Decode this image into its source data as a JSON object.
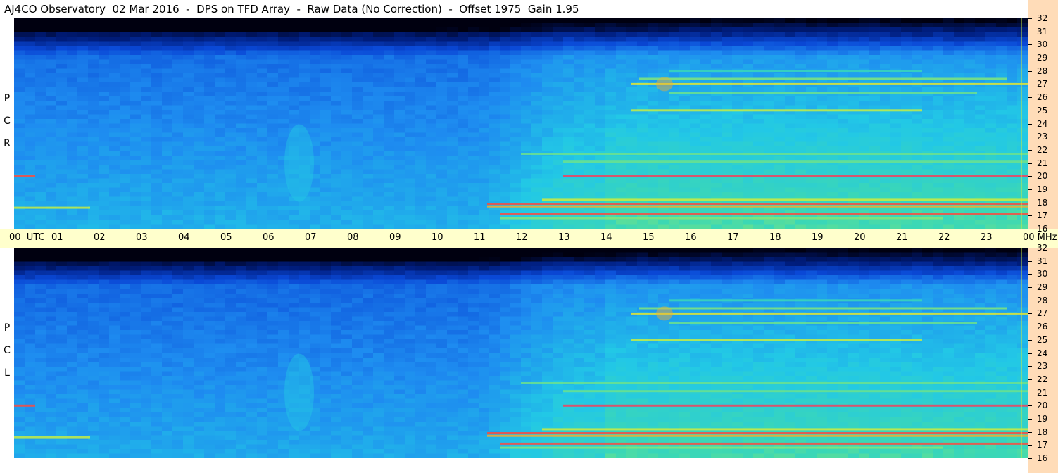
{
  "title": "AJ4CO Observatory  02 Mar 2016  -  DPS on TFD Array  -  Raw Data (No Correction)  -  Offset 1975  Gain 1.95",
  "chart_data": {
    "type": "heatmap",
    "panels": [
      {
        "name": "R C P",
        "letters": [
          "R",
          "C",
          "P"
        ]
      },
      {
        "name": "L C P",
        "letters": [
          "L",
          "C",
          "P"
        ]
      }
    ],
    "x_ticks": [
      "00  UTC",
      "01",
      "02",
      "03",
      "04",
      "05",
      "06",
      "07",
      "08",
      "09",
      "10",
      "11",
      "12",
      "13",
      "14",
      "15",
      "16",
      "17",
      "18",
      "19",
      "20",
      "21",
      "22",
      "23",
      "00 MHz"
    ],
    "x_unit": "UTC",
    "xlim": [
      0,
      24
    ],
    "y_ticks": [
      "32",
      "31",
      "30",
      "29",
      "28",
      "27",
      "26",
      "25",
      "24",
      "23",
      "22",
      "21",
      "20",
      "19",
      "18",
      "17",
      "16"
    ],
    "y_unit": "MHz",
    "ylim": [
      16,
      32
    ],
    "colormap": [
      "#000010",
      "#001c7a",
      "#0a48d6",
      "#1e8cf0",
      "#22c8e6",
      "#3cd8b4",
      "#b4f050",
      "#f0e628",
      "#ff5030",
      "#d01ad6"
    ],
    "features": {
      "bands": [
        {
          "f": 27.0,
          "t0": 14.6,
          "t1": 24.0,
          "v": 0.76
        },
        {
          "f": 27.4,
          "t0": 14.8,
          "t1": 23.5,
          "v": 0.62
        },
        {
          "f": 26.3,
          "t0": 15.5,
          "t1": 22.8,
          "v": 0.6
        },
        {
          "f": 28.0,
          "t0": 15.5,
          "t1": 21.5,
          "v": 0.55
        },
        {
          "f": 25.0,
          "t0": 14.6,
          "t1": 21.5,
          "v": 0.7
        },
        {
          "f": 21.7,
          "t0": 12.0,
          "t1": 24.0,
          "v": 0.6
        },
        {
          "f": 21.1,
          "t0": 13.0,
          "t1": 24.0,
          "v": 0.6
        },
        {
          "f": 20.0,
          "t0": 13.0,
          "t1": 24.0,
          "v": 0.92
        },
        {
          "f": 18.2,
          "t0": 12.5,
          "t1": 24.0,
          "v": 0.72
        },
        {
          "f": 17.9,
          "t0": 11.2,
          "t1": 24.0,
          "v": 0.9
        },
        {
          "f": 17.7,
          "t0": 11.2,
          "t1": 24.0,
          "v": 0.82
        },
        {
          "f": 17.1,
          "t0": 11.5,
          "t1": 24.0,
          "v": 0.9
        },
        {
          "f": 16.8,
          "t0": 11.5,
          "t1": 22.0,
          "v": 0.62
        },
        {
          "f": 20.0,
          "t0": 0.0,
          "t1": 0.5,
          "v": 0.9
        },
        {
          "f": 17.6,
          "t0": 0.0,
          "t1": 1.8,
          "v": 0.7
        }
      ],
      "bursts": [
        {
          "f": 21.0,
          "t0": 6.4,
          "t1": 7.1,
          "v": 0.45
        },
        {
          "f": 27.0,
          "t0": 15.2,
          "t1": 15.6,
          "v": 0.82
        }
      ]
    }
  }
}
